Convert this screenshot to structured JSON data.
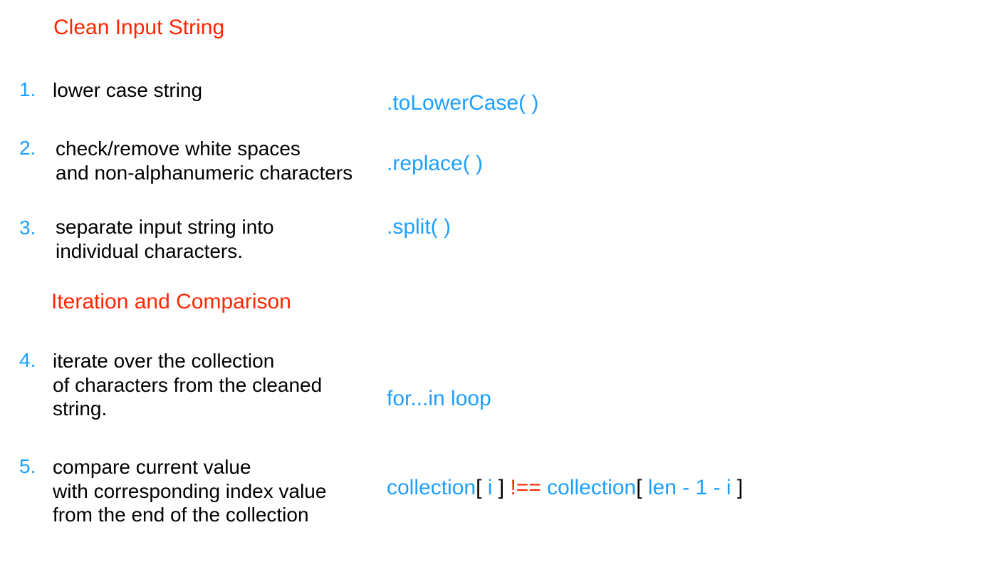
{
  "section1": {
    "title": "Clean Input String"
  },
  "section2": {
    "title": "Iteration and Comparison"
  },
  "steps": {
    "s1": {
      "num": "1.",
      "desc": "lower case string",
      "code": ".toLowerCase( )"
    },
    "s2": {
      "num": "2.",
      "desc": "check/remove white spaces\nand non-alphanumeric characters",
      "code": ".replace( )"
    },
    "s3": {
      "num": "3.",
      "desc": "separate input string into\nindividual characters.",
      "code": ".split( )"
    },
    "s4": {
      "num": "4.",
      "desc": "iterate over the collection\nof characters from the cleaned\nstring.",
      "code": "for...in loop"
    },
    "s5": {
      "num": "5.",
      "desc": "compare current value\nwith corresponding index value\nfrom the end of the collection",
      "code_parts": {
        "p1": "collection",
        "p2": "[ ",
        "p3": "i",
        "p4": " ] ",
        "p5": "!==",
        "p6": " collection",
        "p7": "[ ",
        "p8": "len - 1 - i",
        "p9": " ]"
      }
    }
  }
}
